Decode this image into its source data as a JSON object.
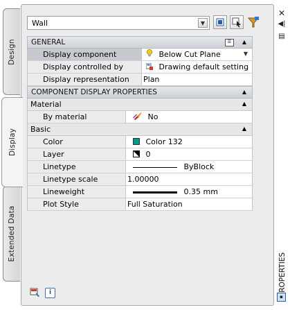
{
  "tabs": [
    "Design",
    "Display",
    "Extended Data"
  ],
  "object_selector": {
    "value": "Wall"
  },
  "general": {
    "title": "GENERAL",
    "rows": [
      {
        "label": "Display component",
        "value": "Below Cut Plane",
        "icon": "lightbulb-icon"
      },
      {
        "label": "Display controlled by",
        "value": "Drawing default setting",
        "icon": "drawing-default-icon"
      },
      {
        "label": "Display representation",
        "value": "Plan"
      }
    ]
  },
  "component": {
    "title": "COMPONENT DISPLAY PROPERTIES",
    "material": {
      "title": "Material",
      "rows": [
        {
          "label": "By material",
          "value": "No",
          "icon": "material-brush-icon"
        }
      ]
    },
    "basic": {
      "title": "Basic",
      "rows": [
        {
          "label": "Color",
          "value": "Color 132",
          "swatch": "#009b8a"
        },
        {
          "label": "Layer",
          "value": "0"
        },
        {
          "label": "Linetype",
          "value": "ByBlock"
        },
        {
          "label": "Linetype scale",
          "value": "1.00000"
        },
        {
          "label": "Lineweight",
          "value": "0.35 mm"
        },
        {
          "label": "Plot Style",
          "value": "Full Saturation"
        }
      ]
    }
  },
  "palette_title": "PROPERTIES"
}
